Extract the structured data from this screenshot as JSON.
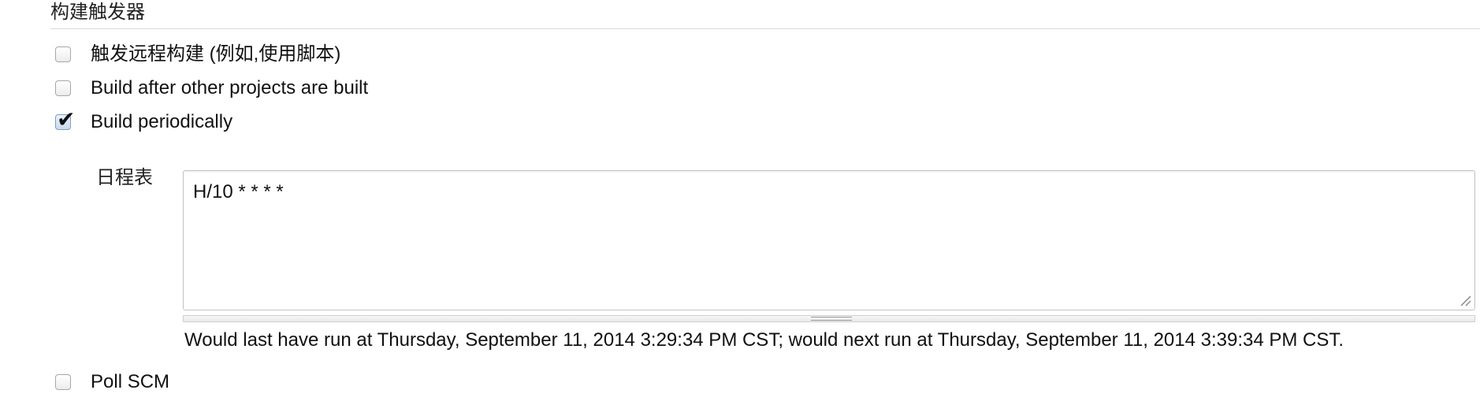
{
  "section": {
    "title": "构建触发器"
  },
  "triggers": [
    {
      "label": "触发远程构建 (例如,使用脚本)",
      "checked": false
    },
    {
      "label": "Build after other projects are built",
      "checked": false
    },
    {
      "label": "Build periodically",
      "checked": true
    },
    {
      "label": "Poll SCM",
      "checked": false
    }
  ],
  "schedule": {
    "label": "日程表",
    "value": "H/10 * * * *",
    "info": "Would last have run at Thursday, September 11, 2014 3:29:34 PM CST; would next run at Thursday, September 11, 2014 3:39:34 PM CST."
  },
  "icons": {
    "checkmark": "check-icon",
    "resize": "resize-grip-icon"
  },
  "colors": {
    "checked_fill": "#c9dbef",
    "rule": "#d9d9d9"
  }
}
